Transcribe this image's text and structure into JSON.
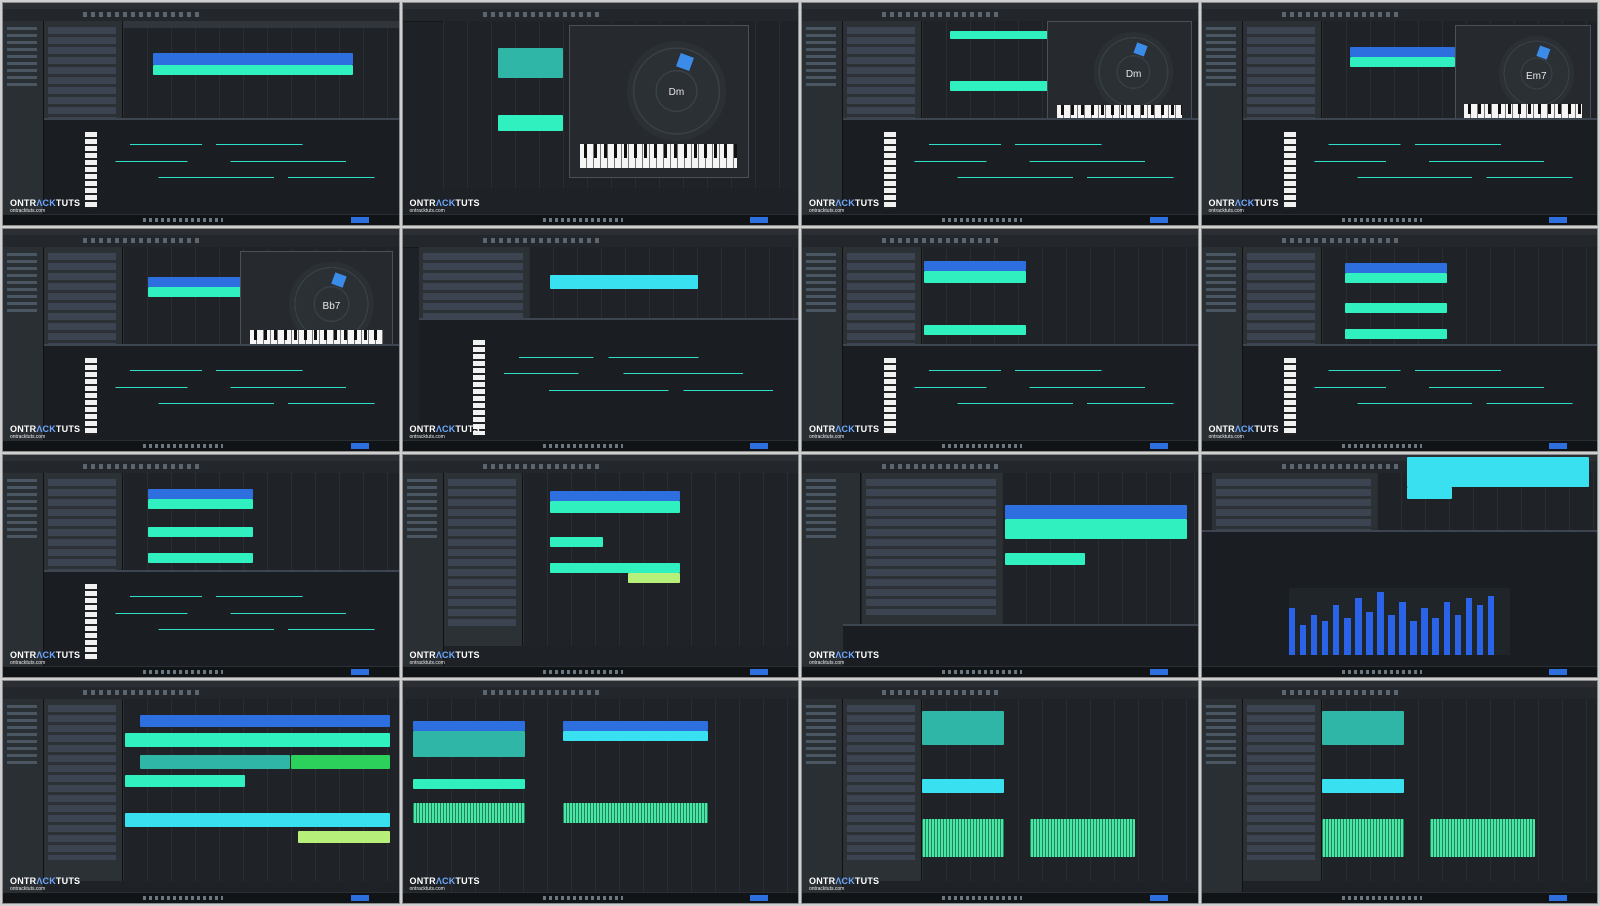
{
  "logo": {
    "main_left": "ONTR",
    "main_accent": "ΛCK",
    "main_right": "TUTS",
    "sub": "ontracktuts.com"
  },
  "popup": {
    "chord_1": "Dm",
    "chord_2": "Dm",
    "chord_3": "Em7",
    "chord_4": "Bb7"
  },
  "colors": {
    "blue": "#2e6fe0",
    "cyan": "#39e0f0",
    "aqua": "#30f0c0",
    "green": "#2bd15a",
    "lime": "#b6f07a"
  }
}
